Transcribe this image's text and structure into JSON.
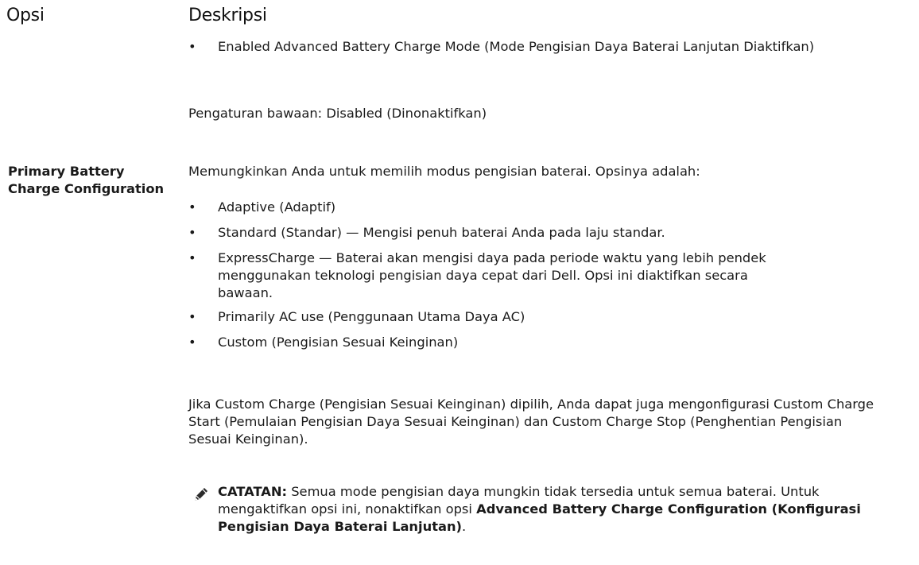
{
  "header": {
    "col1": "Opsi",
    "col2": "Deskripsi"
  },
  "top": {
    "bullet": "Enabled Advanced Battery Charge Mode (Mode Pengisian Daya Baterai Lanjutan Diaktifkan)",
    "default": "Pengaturan bawaan: Disabled (Dinonaktifkan)"
  },
  "option": {
    "name": "Primary Battery Charge Configuration",
    "intro": "Memungkinkan Anda untuk memilih modus pengisian baterai. Opsinya adalah:",
    "items": [
      "Adaptive (Adaptif)",
      "Standard (Standar) — Mengisi penuh baterai Anda pada laju standar.",
      "ExpressCharge — Baterai akan mengisi daya pada periode waktu yang lebih pendek menggunakan teknologi pengisian daya cepat dari Dell. Opsi ini diaktifkan secara bawaan.",
      "Primarily AC use (Penggunaan Utama Daya AC)",
      "Custom (Pengisian Sesuai Keinginan)"
    ],
    "custom_text": "Jika Custom Charge (Pengisian Sesuai Keinginan) dipilih, Anda dapat juga mengonfigurasi Custom Charge Start (Pemulaian Pengisian Daya Sesuai Keinginan) dan Custom Charge Stop (Penghentian Pengisian Sesuai Keinginan)."
  },
  "note": {
    "label": "CATATAN:",
    "text": " Semua mode pengisian daya mungkin tidak tersedia untuk semua baterai. Untuk mengaktifkan opsi ini, nonaktifkan opsi ",
    "bold": "Advanced Battery Charge Configuration (Konfigurasi Pengisian Daya Baterai Lanjutan)",
    "end": ".",
    "icon": "pencil-note-icon"
  }
}
